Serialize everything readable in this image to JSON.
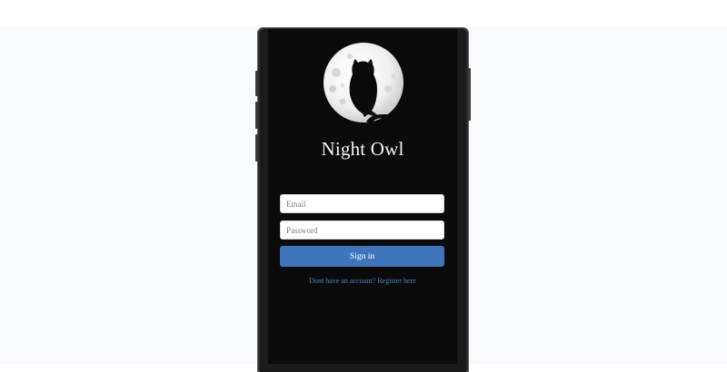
{
  "app": {
    "title": "Night Owl"
  },
  "form": {
    "email_value": "",
    "email_placeholder": "Email",
    "password_value": "",
    "password_placeholder": "Password",
    "signin_label": "Sign in",
    "register_link": "Dont have an account? Register here"
  },
  "icons": {
    "logo": "owl-moon-icon"
  },
  "colors": {
    "screen_bg": "#0b0b0b",
    "button_bg": "#3f76bb",
    "link": "#4a86c8",
    "page_bg": "#f9fafd"
  }
}
